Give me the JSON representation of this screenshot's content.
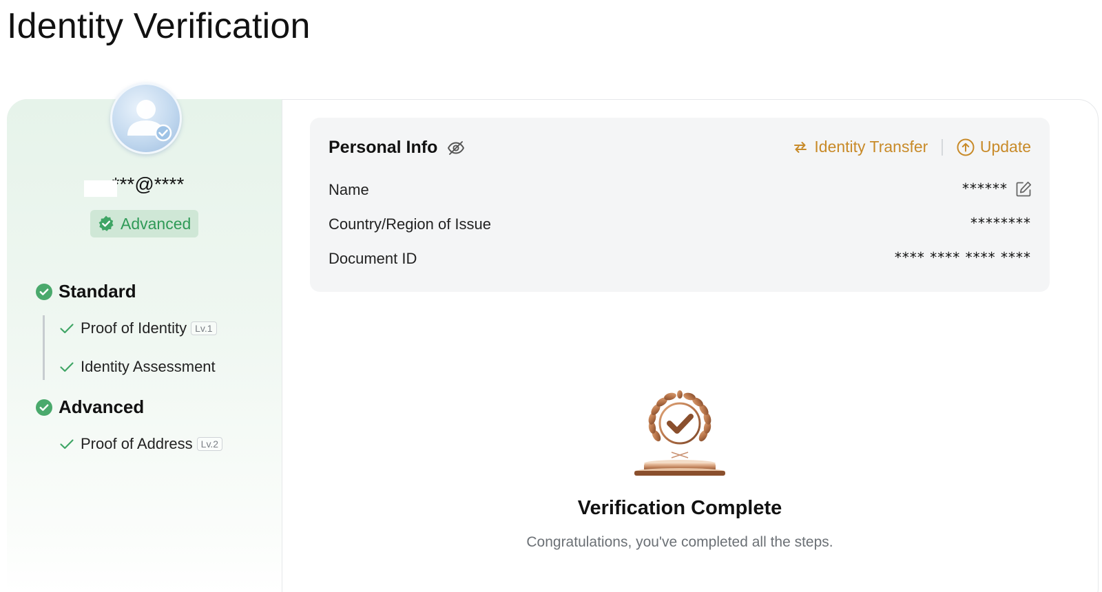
{
  "page": {
    "title": "Identity Verification"
  },
  "profile": {
    "email_masked": "***@****",
    "level_badge": "Advanced",
    "avatar_icon": "user-verified-icon"
  },
  "progress": {
    "tiers": [
      {
        "label": "Standard",
        "status_icon": "check-circle-icon",
        "steps": [
          {
            "label": "Proof of Identity",
            "tag": "Lv.1"
          },
          {
            "label": "Identity Assessment"
          }
        ]
      },
      {
        "label": "Advanced",
        "status_icon": "check-circle-icon",
        "steps": [
          {
            "label": "Proof of Address",
            "tag": "Lv.2"
          }
        ]
      }
    ]
  },
  "personal_info": {
    "title": "Personal Info",
    "actions": {
      "transfer": "Identity Transfer",
      "update": "Update"
    },
    "rows": [
      {
        "label": "Name",
        "value": "******"
      },
      {
        "label": "Country/Region of Issue",
        "value": "********"
      },
      {
        "label": "Document ID",
        "value": "**** **** **** ****"
      }
    ]
  },
  "completion": {
    "title": "Verification Complete",
    "subtitle": "Congratulations, you've completed all the steps."
  },
  "colors": {
    "accent_gold": "#c88a28",
    "success_green": "#2f9a57",
    "badge_bg": "#cfe7d6"
  }
}
